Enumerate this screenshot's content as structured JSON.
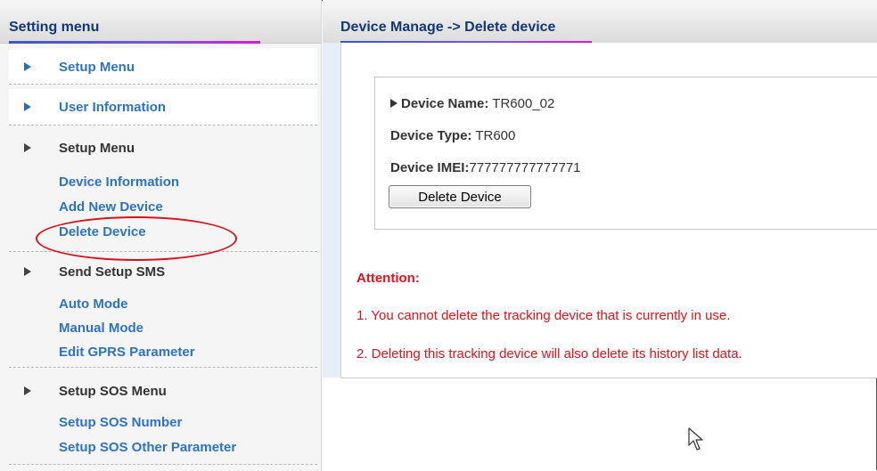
{
  "sidebar": {
    "title": "Setting menu",
    "top_items": [
      {
        "label": "Setup Menu"
      },
      {
        "label": "User Information"
      }
    ],
    "groups": [
      {
        "label": "Setup Menu",
        "links": [
          "Device Information",
          "Add New Device",
          "Delete Device"
        ]
      },
      {
        "label": "Send Setup SMS",
        "links": [
          "Auto Mode",
          "Manual Mode",
          "Edit GPRS Parameter"
        ]
      },
      {
        "label": "Setup SOS Menu",
        "links": [
          "Setup SOS Number",
          "Setup SOS Other Parameter"
        ]
      }
    ]
  },
  "main": {
    "breadcrumb": "Device Manage -> Delete device",
    "device": {
      "name_label": "Device Name:",
      "name": "TR600_02",
      "type_label": "Device Type:",
      "type": "TR600",
      "imei_label": "Device IMEI:",
      "imei": "777777777777771"
    },
    "delete_button": "Delete Device",
    "attention": {
      "title": "Attention:",
      "notes": [
        "1. You cannot delete the tracking device that is currently in use.",
        "2. Deleting this tracking device will also delete its history list data."
      ]
    }
  },
  "colors": {
    "link": "#2e73c3",
    "heading": "#13377a",
    "warning": "#e0121a",
    "highlight_oval": "#d8101a"
  },
  "icons": [
    "triangle-right-icon",
    "mouse-pointer-icon"
  ]
}
